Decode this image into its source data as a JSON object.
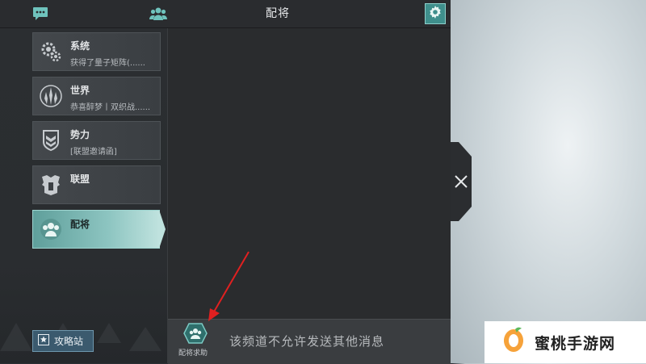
{
  "topbar": {
    "title": "配将",
    "icons": [
      "chat-icon",
      "group-icon",
      "gear-icon"
    ]
  },
  "sidebar": {
    "channels": [
      {
        "name": "系统",
        "preview": "获得了量子矩阵(......",
        "icon": "gear-cluster-icon",
        "active": false
      },
      {
        "name": "世界",
        "preview": "恭喜醉梦丨双织战......",
        "icon": "world-spire-icon",
        "active": false
      },
      {
        "name": "势力",
        "preview": "[联盟邀请函]",
        "icon": "faction-shield-icon",
        "active": false
      },
      {
        "name": "联盟",
        "preview": "",
        "icon": "alliance-armor-icon",
        "active": true
      },
      {
        "name": "配将",
        "preview": "",
        "icon": "commander-team-icon",
        "active": true
      }
    ],
    "guide_button": "攻略站"
  },
  "bottom": {
    "help_button": "配将求助",
    "notice": "该频道不允许发送其他消息"
  },
  "watermark": {
    "text": "蜜桃手游网"
  },
  "colors": {
    "accent": "#3f8f8c",
    "active_channel": "#8dc5c1",
    "annotation_arrow": "#e02020"
  }
}
